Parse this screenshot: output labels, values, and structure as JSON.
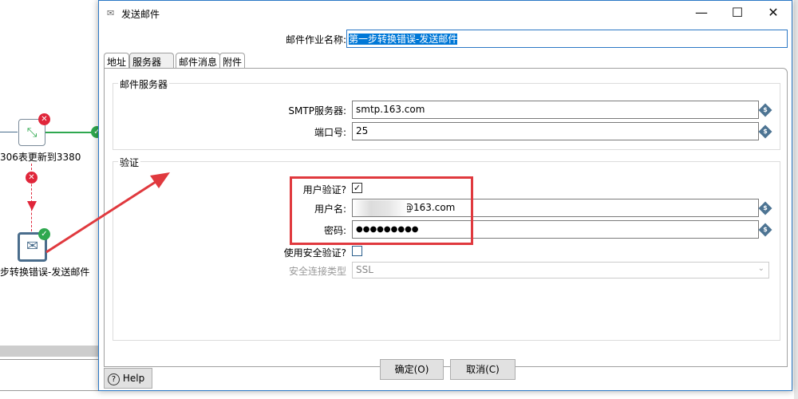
{
  "canvas": {
    "step1_label": "306表更新到3380",
    "step2_label": "步转换错误-发送邮件"
  },
  "dialog": {
    "title": "发送邮件",
    "job_name_label": "邮件作业名称:",
    "job_name_value": "第一步转换错误-发送邮件",
    "tabs": [
      {
        "label": "地址"
      },
      {
        "label": "服务器"
      },
      {
        "label": "邮件消息"
      },
      {
        "label": "附件"
      }
    ],
    "server_group": {
      "title": "邮件服务器",
      "smtp_label": "SMTP服务器:",
      "smtp_value": "smtp.163.com",
      "port_label": "端口号:",
      "port_value": "25"
    },
    "auth_group": {
      "title": "验证",
      "use_auth_label": "用户验证?",
      "use_auth_checked": true,
      "username_label": "用户名:",
      "username_value": "@163.com",
      "password_label": "密码:",
      "password_value": "●●●●●●●●●",
      "secure_label": "使用安全验证?",
      "secure_checked": false,
      "conn_type_label": "安全连接类型",
      "conn_type_value": "SSL"
    },
    "ok_label": "确定(O)",
    "cancel_label": "取消(C)",
    "help_label": "Help"
  },
  "colors": {
    "accent": "#2b78c5",
    "highlight": "#e0393e",
    "error": "#e0263a",
    "ok": "#2fa84f"
  }
}
